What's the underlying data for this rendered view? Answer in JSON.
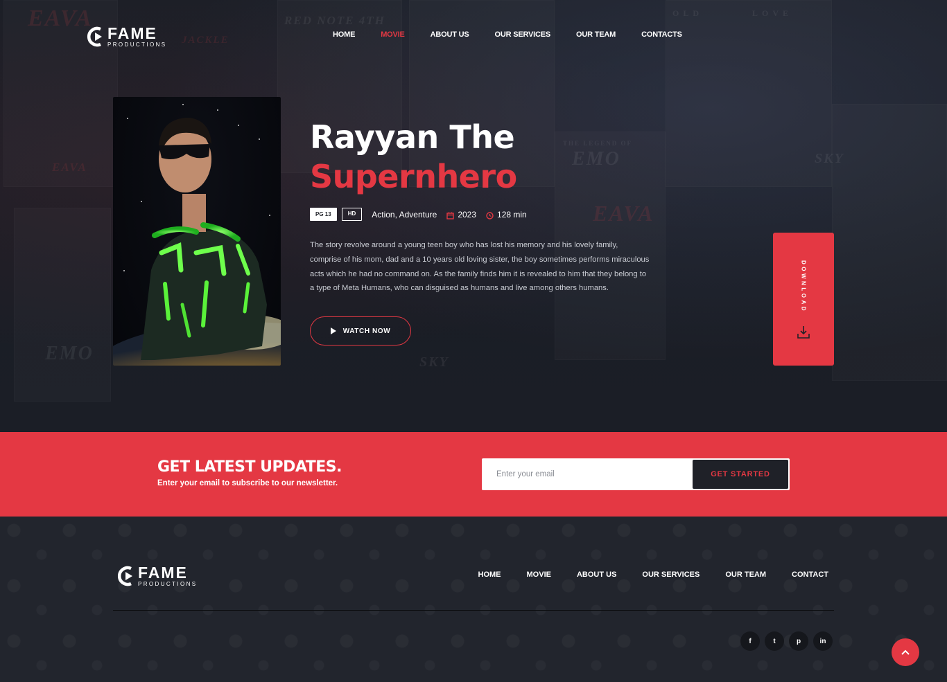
{
  "brand": {
    "name": "FAME",
    "tagline": "PRODUCTIONS"
  },
  "nav": {
    "items": [
      {
        "label": "HOME",
        "active": false
      },
      {
        "label": "MOVIE",
        "active": true
      },
      {
        "label": "ABOUT US",
        "active": false
      },
      {
        "label": "OUR SERVICES",
        "active": false
      },
      {
        "label": "OUR TEAM",
        "active": false
      },
      {
        "label": "CONTACTS",
        "active": false
      }
    ]
  },
  "movie": {
    "title_line1": "Rayyan The",
    "title_line2": "Supernhero",
    "rating": "PG 13",
    "quality": "HD",
    "genres": "Action, Adventure",
    "year": "2023",
    "duration": "128 min",
    "description": "The story revolve around a young teen boy who has lost his memory and his lovely family, comprise of his mom, dad and a 10 years old loving sister, the boy sometimes performs miraculous acts which he had no command on. As the family finds him it is revealed to him that they belong to a type of Meta Humans, who can disguised as humans and live among others humans.",
    "watch_label": "WATCH NOW",
    "download_label": "DOWNLOAD"
  },
  "background_posters": {
    "texts": [
      "EAVA",
      "RED NOTE 4TH",
      "JACKLE",
      "OLD",
      "LOVE",
      "THE LEGEND OF",
      "EMO",
      "SKY",
      "EAVA",
      "EAVA",
      "EMO",
      "SKY"
    ]
  },
  "newsletter": {
    "title": "GET LATEST UPDATES.",
    "subtitle": "Enter your email to subscribe to our newsletter.",
    "placeholder": "Enter your email",
    "button_label": "GET STARTED"
  },
  "footer": {
    "nav": [
      "HOME",
      "MOVIE",
      "ABOUT US",
      "OUR SERVICES",
      "OUR TEAM",
      "CONTACT"
    ],
    "socials": [
      {
        "icon": "facebook-icon",
        "glyph": "f"
      },
      {
        "icon": "twitter-icon",
        "glyph": "t"
      },
      {
        "icon": "pinterest-icon",
        "glyph": "p"
      },
      {
        "icon": "linkedin-icon",
        "glyph": "in"
      }
    ]
  },
  "colors": {
    "accent": "#e43843",
    "background": "#1f2128",
    "footer_bg": "#22252d",
    "button_dark": "#1f2128"
  }
}
